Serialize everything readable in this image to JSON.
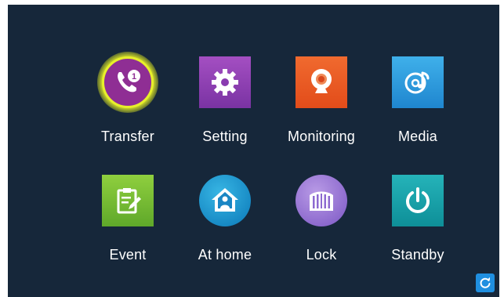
{
  "menu": {
    "items": [
      {
        "label": "Transfer",
        "icon": "phone-transfer-icon"
      },
      {
        "label": "Setting",
        "icon": "gear-icon"
      },
      {
        "label": "Monitoring",
        "icon": "webcam-icon"
      },
      {
        "label": "Media",
        "icon": "music-disc-icon"
      },
      {
        "label": "Event",
        "icon": "clipboard-edit-icon"
      },
      {
        "label": "At home",
        "icon": "house-person-icon"
      },
      {
        "label": "Lock",
        "icon": "gate-icon"
      },
      {
        "label": "Standby",
        "icon": "power-icon"
      }
    ],
    "transfer_badge": "1"
  },
  "colors": {
    "background": "#16273a",
    "highlight": "#e7ef2b",
    "refresh_button": "#1f8fe0"
  },
  "corner_button": {
    "icon": "refresh-icon"
  }
}
